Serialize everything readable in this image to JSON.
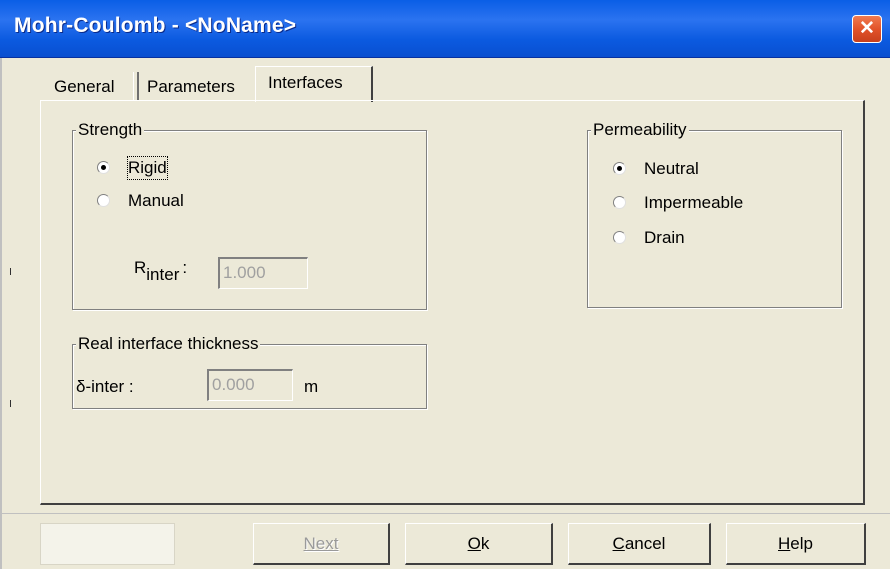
{
  "window": {
    "title": "Mohr-Coulomb - <NoName>",
    "close_glyph": "✕"
  },
  "tabs": [
    {
      "label": "General"
    },
    {
      "label": "Parameters"
    },
    {
      "label": "Interfaces",
      "active": true
    }
  ],
  "strength": {
    "legend": "Strength",
    "options": [
      {
        "label": "Rigid",
        "checked": true
      },
      {
        "label": "Manual",
        "checked": false
      }
    ],
    "rinter_label_main": "R",
    "rinter_label_sub": "inter",
    "rinter_colon": ":",
    "rinter_value": "1.000"
  },
  "permeability": {
    "legend": "Permeability",
    "options": [
      {
        "label": "Neutral",
        "checked": true
      },
      {
        "label": "Impermeable",
        "checked": false
      },
      {
        "label": "Drain",
        "checked": false
      }
    ]
  },
  "thickness": {
    "legend": "Real interface thickness",
    "label": "δ-inter :",
    "value": "0.000",
    "unit": "m"
  },
  "buttons": {
    "next": "Next",
    "ok_accel": "O",
    "ok_rest": "k",
    "cancel_accel": "C",
    "cancel_rest": "ancel",
    "help_accel": "H",
    "help_rest": "elp"
  },
  "colors": {
    "titlebar": "#0a5ee6",
    "close": "#e2532a",
    "dialog_bg": "#ece9d8"
  }
}
